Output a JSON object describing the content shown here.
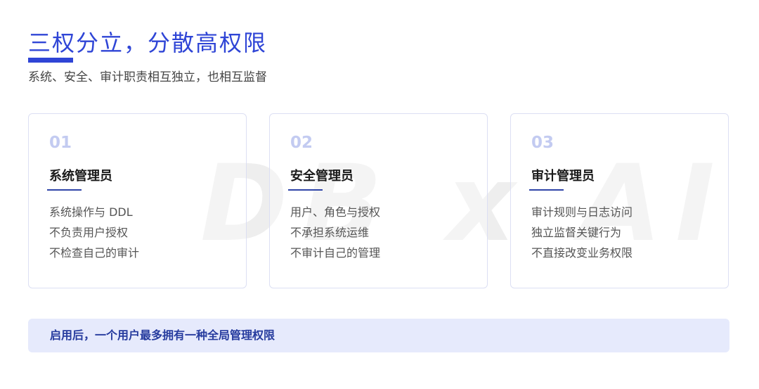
{
  "header": {
    "title": "三权分立，分散高权限",
    "subtitle": "系统、安全、审计职责相互独立，也相互监督"
  },
  "watermark": "DB x AI",
  "cards": [
    {
      "number": "01",
      "heading": "系统管理员",
      "lines": [
        "系统操作与 DDL",
        "不负责用户授权",
        "不检查自己的审计"
      ]
    },
    {
      "number": "02",
      "heading": "安全管理员",
      "lines": [
        "用户、角色与授权",
        "不承担系统运维",
        "不审计自己的管理"
      ]
    },
    {
      "number": "03",
      "heading": "审计管理员",
      "lines": [
        "审计规则与日志访问",
        "独立监督关键行为",
        "不直接改变业务权限"
      ]
    }
  ],
  "banner": {
    "text": "启用后，一个用户最多拥有一种全局管理权限"
  },
  "colors": {
    "accent": "#2f45d6",
    "number": "#c3cbf1",
    "banner_bg": "#e6eafc",
    "banner_text": "#263b9e",
    "card_border": "#dcdff3"
  }
}
